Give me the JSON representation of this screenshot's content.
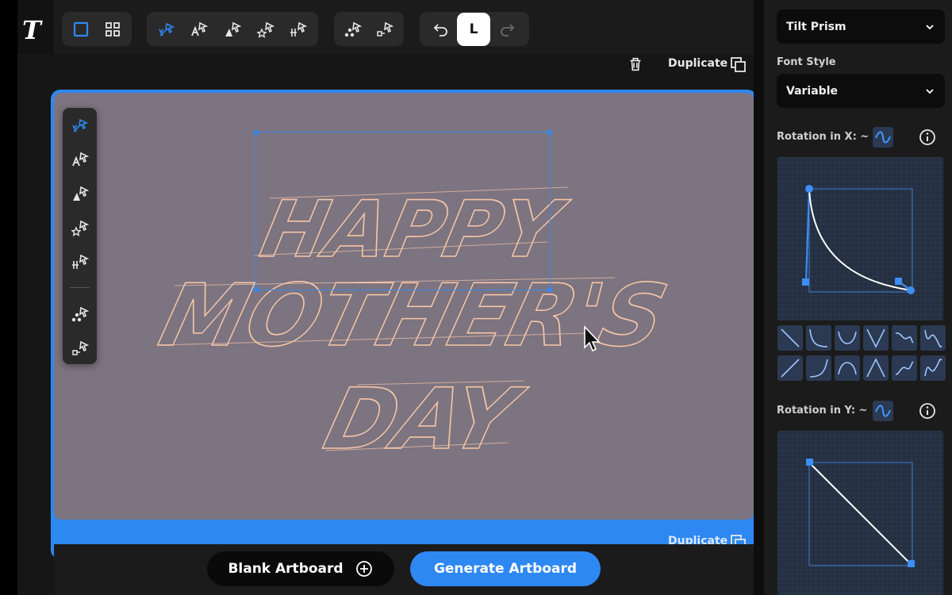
{
  "app": {
    "logo": "T"
  },
  "toolbar": {
    "undo_label": "undo",
    "align_label": "L",
    "redo_label": "redo"
  },
  "artboard": {
    "duplicate_label": "Duplicate",
    "duplicate_label_2": "Duplicate",
    "text_lines": [
      "HAPPY",
      "MOTHER'S",
      "DAY"
    ],
    "background_color": "#7c7480",
    "text_color": "#f6c5a6",
    "accent_color": "#2e88f2"
  },
  "bottom": {
    "blank_label": "Blank Artboard",
    "generate_label": "Generate Artboard"
  },
  "panel": {
    "font_select": "Tilt Prism",
    "font_style_label": "Font Style",
    "font_style_select": "Variable",
    "rotation_x_label": "Rotation in X: ~",
    "rotation_y_label": "Rotation in Y: ~"
  }
}
